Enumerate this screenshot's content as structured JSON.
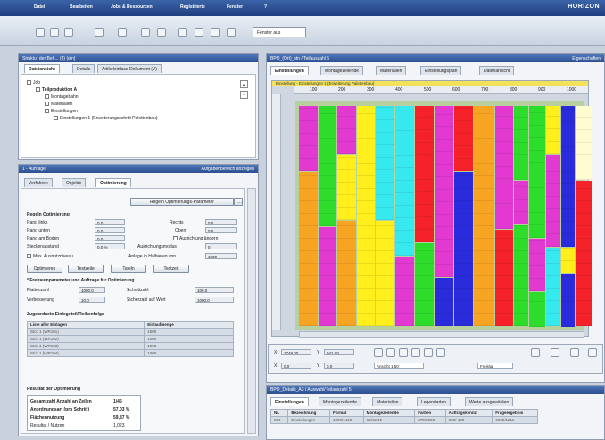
{
  "menubar": {
    "items": [
      "Datei",
      "Bearbeiten",
      "Jobs & Ressourcen",
      "Registrierte",
      "Fenster",
      "?"
    ],
    "logo": "HORIZON"
  },
  "toolbar": {
    "zoom": "Fenster aus"
  },
  "left_top": {
    "header": "Struktur der Beh... (3) (ein)",
    "tabs": [
      "Dateiansicht",
      "Details",
      "Artikeleinlass-Dokument (V)"
    ],
    "tree": [
      "Job",
      "Teilproduktion A",
      "Montagebahn",
      "Materialien",
      "Einstellungen",
      "Einstellungen 1 (Erweiterungsschritt Palettenbau)"
    ]
  },
  "left_bottom": {
    "header": "1 - Aufträge",
    "header_right": "Aufgabenbereich anzeigen",
    "tabs": [
      "Verfahren",
      "Objekte",
      "Optimierung"
    ],
    "general_button": "Regeln Optimierungs-Parameter",
    "sections": {
      "s1": "Regeln Optimierung",
      "s2": "* Freiraumparameter und Auftrage fur Optimierung",
      "s3": "Zugeordnete Einlegeteil/Reihenfolge",
      "s4": "Resultat der Optimierung"
    },
    "fields_left": [
      {
        "label": "Rand links",
        "value": "0,0"
      },
      {
        "label": "Rand unten",
        "value": "0,0"
      },
      {
        "label": "Rand am Boden",
        "value": "0,0"
      },
      {
        "label": "Steckenabstand",
        "value": "0,0 %"
      }
    ],
    "fields_right": [
      {
        "label": "Rechts",
        "value": "0,0"
      },
      {
        "label": "Oben",
        "value": "0,0"
      },
      {
        "label": "Ausrichtung ändern",
        "value": ""
      },
      {
        "label": "Ausrichtungsmodus",
        "value": "0"
      }
    ],
    "check1": "Max. Ausnutzniveau",
    "check1_right": "Anlage in Halbieren von",
    "check1_value": "1000",
    "buttons": [
      "Optimieren",
      "Testzeile",
      "Tafeln",
      "Testzeit"
    ],
    "params": [
      {
        "label": "Plattenzahl",
        "value": "1000,0"
      },
      {
        "label": "Schnittzahl",
        "value": "100,0"
      },
      {
        "label": "Verbesserung",
        "value": "10,0"
      },
      {
        "label": "Sicherzahl auf Wert",
        "value": "1000,0"
      }
    ],
    "table_headers": [
      "Liste aller Einlagen",
      "Einlaufmenge"
    ],
    "table_rows": [
      [
        "Stck 1 (WR101)",
        "1500"
      ],
      [
        "Stck 1 (WR102)",
        "1000"
      ],
      [
        "Stck 1 (WR103)",
        "1000"
      ],
      [
        "Stck 1 (WR104)",
        "1000"
      ]
    ],
    "results": [
      {
        "label": "Gesamtzahl Anzahl an Zeilen",
        "value": "1/45"
      },
      {
        "label": "Anordnungsart (pro Schritt)",
        "value": "57,03 %"
      },
      {
        "label": "Flächennutzung",
        "value": "59,87 %"
      },
      {
        "label": "Resultat / Nutzen",
        "value": "1,023"
      }
    ]
  },
  "right_main": {
    "header": "BPO_(Ort)_stn / Teilauszahl 5",
    "header_right": "Eigenschaften",
    "tabs": [
      "Einstellungen",
      "Montagezeilende",
      "Materialien",
      "Einstellungsplan",
      "Datenansicht"
    ],
    "banner": "Einstellung - Einstellungen 1 (Erweiterung Palettenbau)",
    "ruler_ticks": [
      "100",
      "200",
      "300",
      "400",
      "500",
      "600",
      "700",
      "800",
      "900",
      "1000"
    ]
  },
  "canvas_ctrl": {
    "x_label": "X",
    "x_value": "1748,00",
    "y_label": "Y",
    "y_value": "941,00",
    "sx_label": "X",
    "sx_value": "0,0",
    "sy_label": "Y",
    "sy_value": "0,0",
    "mode_value": "Ansicht 1:50",
    "right_select": "Freiräg"
  },
  "bottom_panel": {
    "header": "BPO_Details_A3 / Auswahl/Teilauszahl 5",
    "tabs": [
      "Einstellungen",
      "Montagezeilende",
      "Materialien",
      "Legendarten",
      "Werte ausgewählen"
    ],
    "headers": [
      "Nr.",
      "Bezeichnung",
      "Format",
      "Montagezeilende",
      "Farben",
      "Auftragskennz.",
      "Frageergebnis"
    ],
    "row": [
      "001",
      "Einstellungen",
      "1000/1410",
      "62/12/15",
      "375/5003",
      "900/-100",
      "4660/1211"
    ]
  },
  "colors": {
    "magenta": "#e23ad1",
    "green": "#2edd2c",
    "orange": "#f8a423",
    "yellow": "#ffef1d",
    "cyan": "#35e9ef",
    "red": "#f5222a",
    "blue": "#2a2cdc",
    "cream": "#fffccf",
    "grey_cell": "#d7d8d8",
    "title_blue": "#2c4f91"
  }
}
